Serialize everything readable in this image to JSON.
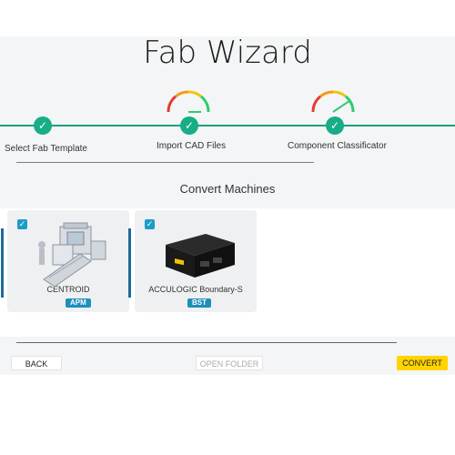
{
  "app": {
    "title": "Fab Wizard"
  },
  "stepper": {
    "steps": [
      {
        "label": "Select Fab Template",
        "completed": true
      },
      {
        "label": "Import CAD Files",
        "completed": true
      },
      {
        "label": "Component Classificator",
        "completed": true
      }
    ]
  },
  "section": {
    "title": "Convert Machines"
  },
  "machines": [
    {
      "name": "CENTROID",
      "badge": "APM",
      "selected": true
    },
    {
      "name": "ACCULOGIC Boundary-S",
      "badge": "BST",
      "selected": true
    }
  ],
  "footer": {
    "back_label": "BACK",
    "open_folder_label": "OPEN FOLDER",
    "convert_label": "CONVERT"
  },
  "colors": {
    "accent_green": "#17ad86",
    "checkbox_blue": "#1a9dc8",
    "badge_blue": "#1d8fbc",
    "convert_yellow": "#ffd400"
  },
  "icons": [
    "check-icon",
    "gauge-icon",
    "checkbox-icon"
  ]
}
